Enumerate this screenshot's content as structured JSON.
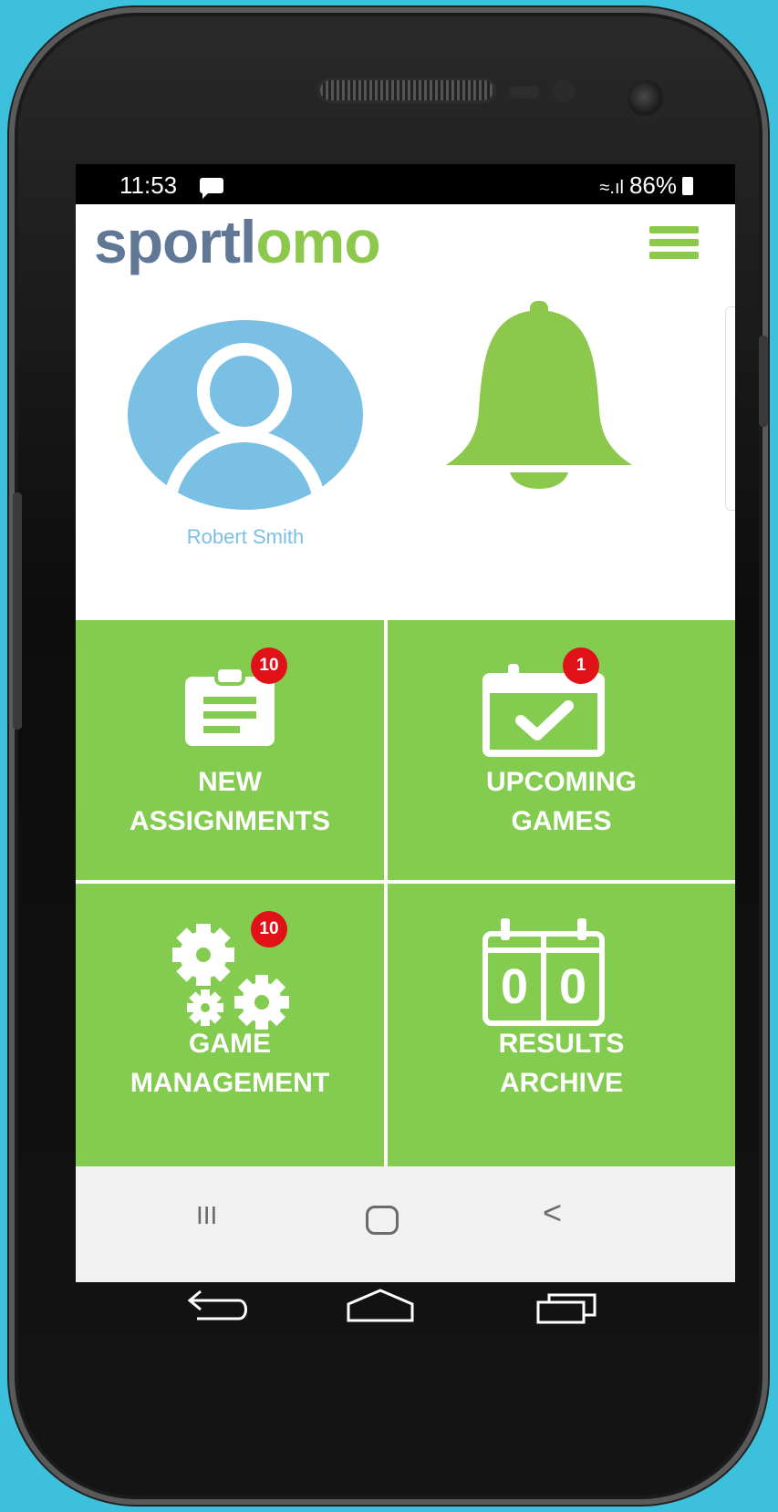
{
  "status_bar": {
    "time": "11:53",
    "signal": "◢…▎",
    "battery": "86%"
  },
  "header": {
    "logo_part1": "sportl",
    "logo_part2": "omo",
    "menu_icon": "hamburger-icon"
  },
  "profile": {
    "name": "Robert Smith",
    "avatar_icon": "user-avatar-icon"
  },
  "notifications": {
    "icon": "bell-icon"
  },
  "tiles": [
    {
      "label_line1": "NEW",
      "label_line2": "ASSIGNMENTS",
      "badge": "10",
      "icon": "clipboard-icon"
    },
    {
      "label_line1": "UPCOMING",
      "label_line2": "GAMES",
      "badge": "1",
      "icon": "calendar-check-icon"
    },
    {
      "label_line1": "GAME",
      "label_line2": "MANAGEMENT",
      "badge": "10",
      "icon": "gears-icon"
    },
    {
      "label_line1": "RESULTS",
      "label_line2": "ARCHIVE",
      "score_left": "0",
      "score_right": "0",
      "icon": "scoreboard-icon"
    }
  ],
  "nav_bar": {
    "recents": "III",
    "home": "",
    "back": "<"
  },
  "colors": {
    "brand_green": "#84cc50",
    "brand_blue": "#7ac0e4",
    "logo_grey": "#607896",
    "badge_red": "#e01218",
    "background": "#3cc0dc"
  }
}
